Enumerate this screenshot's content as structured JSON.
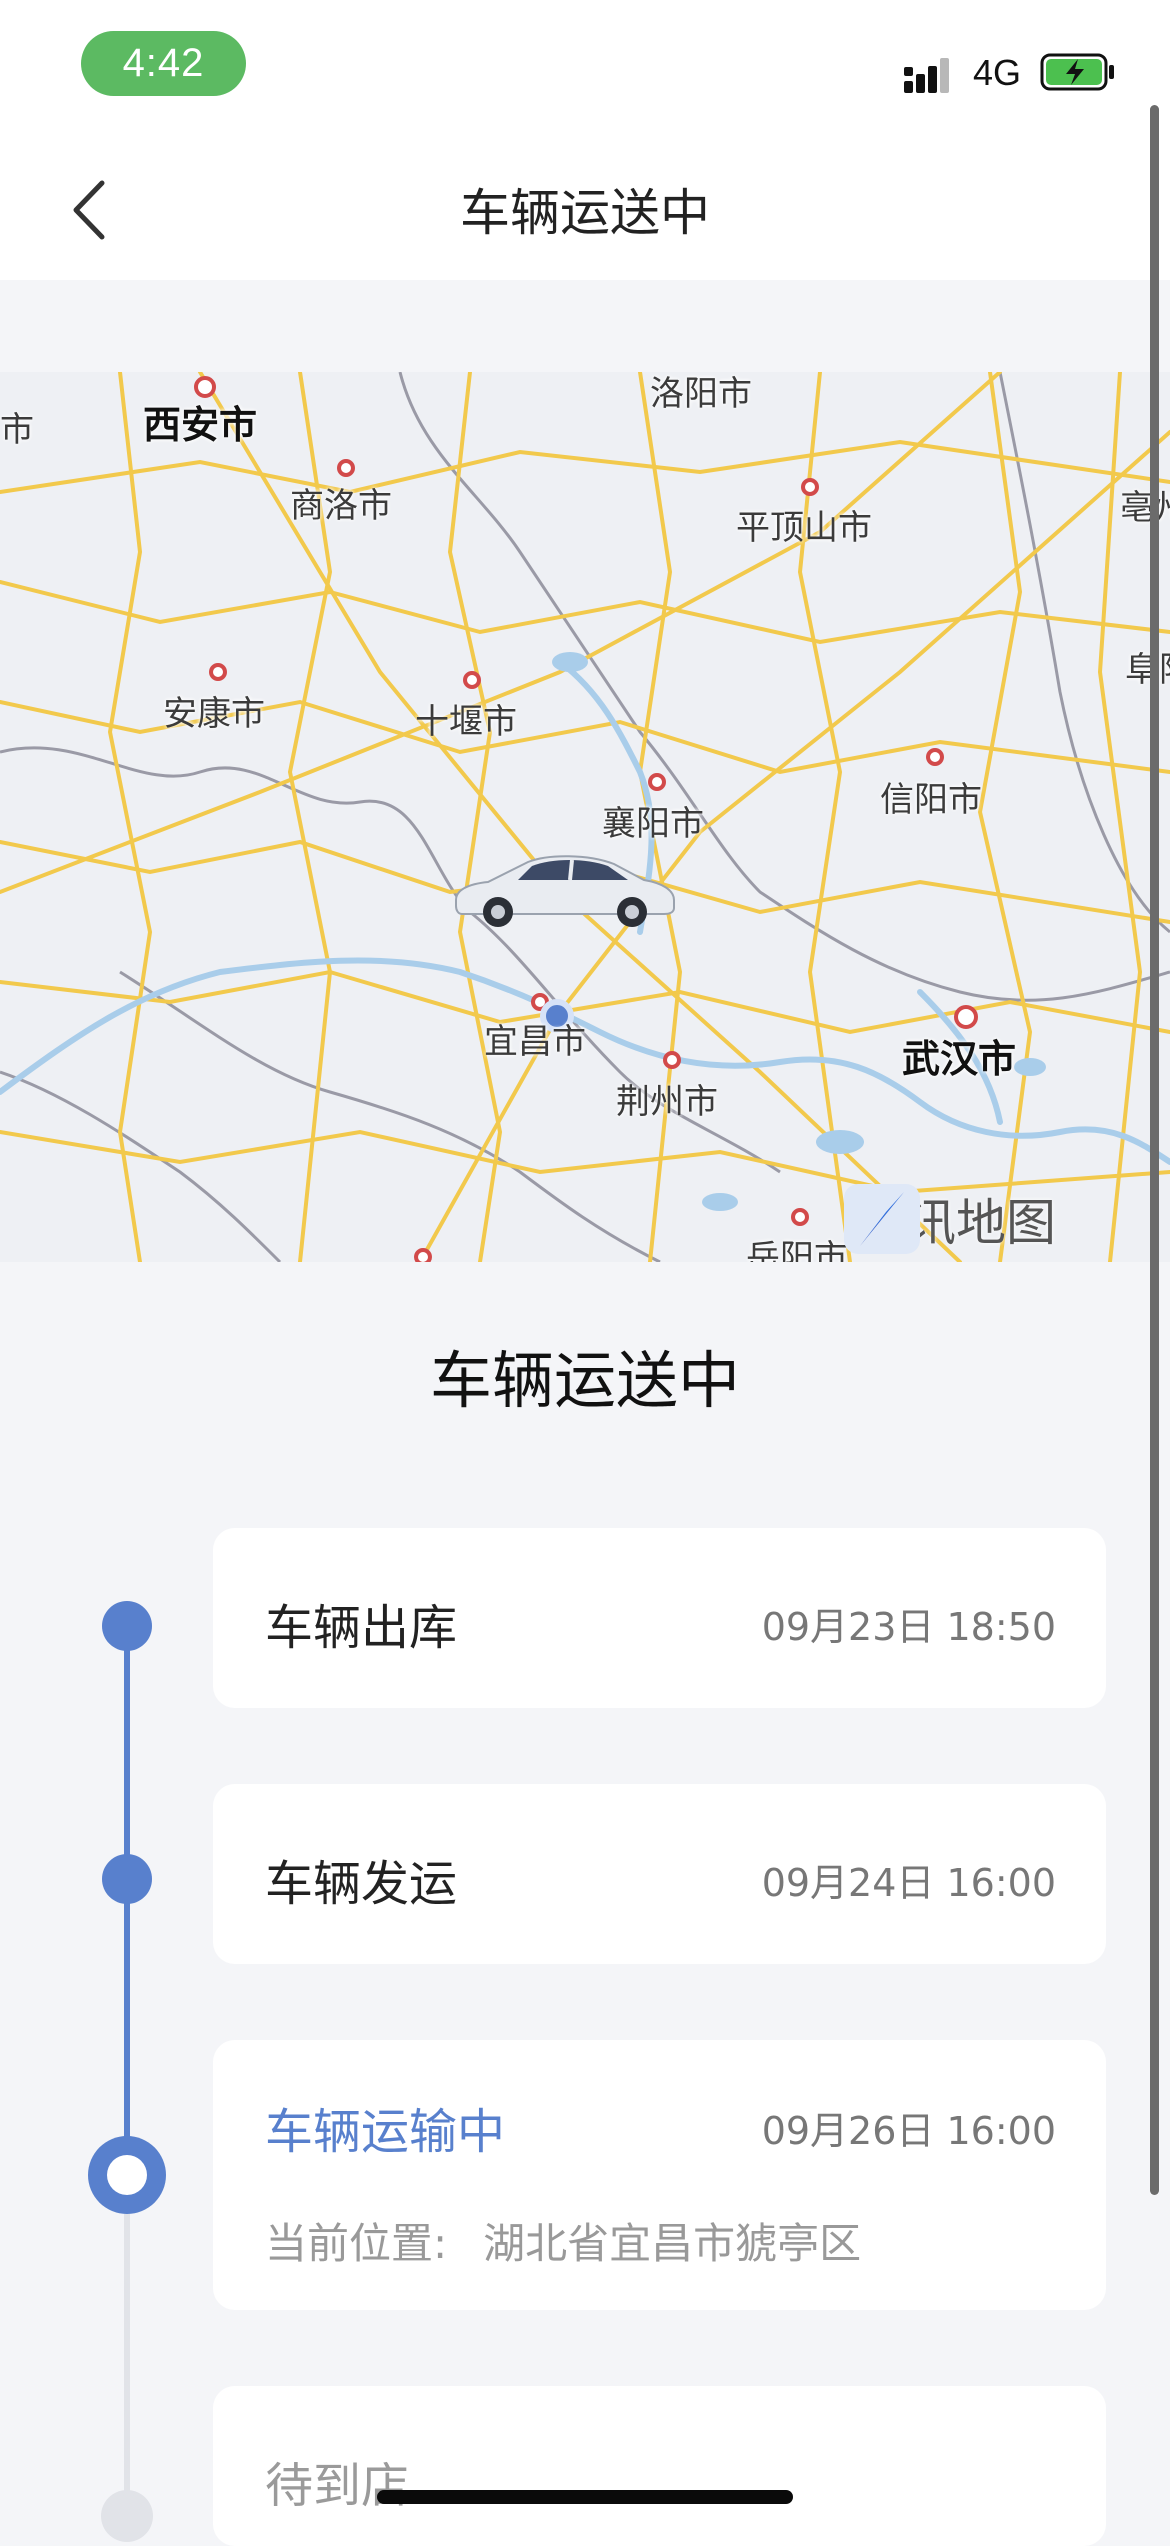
{
  "status_bar": {
    "time": "4:42",
    "network": "4G"
  },
  "nav": {
    "title": "车辆运送中"
  },
  "map": {
    "cities": [
      {
        "name": "西安市",
        "bold": true
      },
      {
        "name": "商洛市",
        "bold": false
      },
      {
        "name": "平顶山市",
        "bold": false
      },
      {
        "name": "安康市",
        "bold": false
      },
      {
        "name": "十堰市",
        "bold": false
      },
      {
        "name": "襄阳市",
        "bold": false
      },
      {
        "name": "信阳市",
        "bold": false
      },
      {
        "name": "宜昌市",
        "bold": false
      },
      {
        "name": "荆州市",
        "bold": false
      },
      {
        "name": "武汉市",
        "bold": true
      },
      {
        "name": "洛阳市",
        "bold": false
      },
      {
        "name": "岳阳市",
        "bold": false
      },
      {
        "name": "亳州",
        "bold": false
      },
      {
        "name": "阜阳",
        "bold": false
      },
      {
        "name": "市",
        "bold": false
      }
    ],
    "attribution": "腾讯地图",
    "colors": {
      "road": "#f2c94c",
      "water": "#a9cdea",
      "border": "#9a9aa6",
      "background": "#eef0f4"
    }
  },
  "status_heading": "车辆运送中",
  "timeline": [
    {
      "title": "车辆出库",
      "time": "09月23日 18:50",
      "state": "done"
    },
    {
      "title": "车辆发运",
      "time": "09月24日 16:00",
      "state": "done"
    },
    {
      "title": "车辆运输中",
      "time": "09月26日 16:00",
      "state": "current",
      "location_label": "当前位置:",
      "location_value": "湖北省宜昌市猇亭区"
    },
    {
      "title": "待到店",
      "time": "",
      "state": "pending"
    }
  ],
  "colors": {
    "accent": "#5880cd",
    "pending": "#e1e3e8",
    "time_pill": "#5cba62"
  }
}
